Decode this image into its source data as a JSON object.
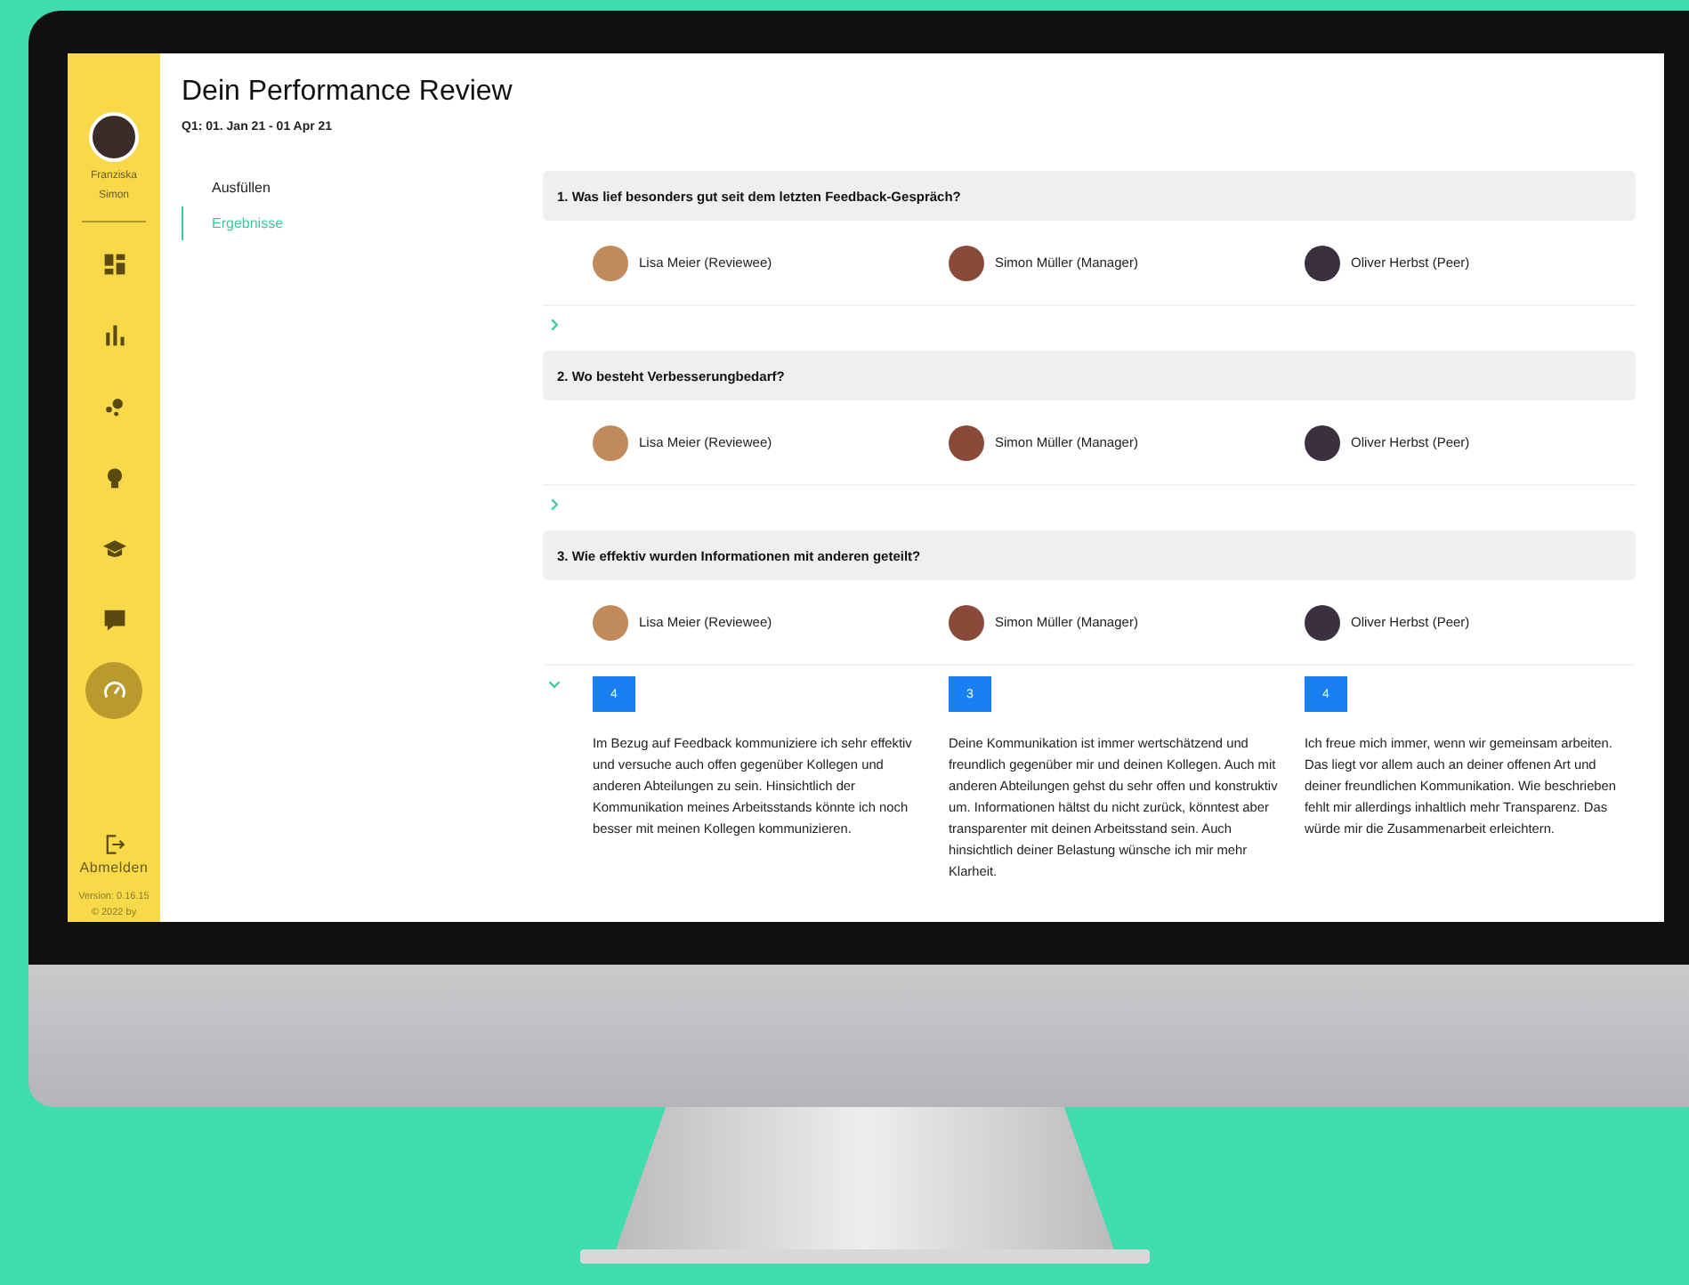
{
  "sidebar": {
    "user_name": "Franziska Simon",
    "items": [
      {
        "kind": "dashboard",
        "selected": false
      },
      {
        "kind": "chart",
        "selected": false
      },
      {
        "kind": "bubbles",
        "selected": false
      },
      {
        "kind": "bulb",
        "selected": false
      },
      {
        "kind": "cap",
        "selected": false
      },
      {
        "kind": "quote",
        "selected": false
      },
      {
        "kind": "gauge",
        "selected": true
      }
    ],
    "logout": "Abmelden",
    "version": "Version: 0.16.15",
    "copyright": "© 2022 by"
  },
  "header": {
    "title": "Dein Performance Review",
    "period": "Q1: 01. Jan 21 - 01 Apr 21"
  },
  "tabs": [
    {
      "label": "Ausfüllen",
      "selected": false
    },
    {
      "label": "Ergebnisse",
      "selected": true
    }
  ],
  "questions": [
    {
      "title": "1. Was lief besonders gut seit dem letzten Feedback-Gespräch?",
      "expanded": false,
      "reviewers": [
        "Lisa Meier (Reviewee)",
        "Simon Müller (Manager)",
        "Oliver Herbst (Peer)"
      ]
    },
    {
      "title": "2. Wo besteht Verbesserungbedarf?",
      "expanded": false,
      "reviewers": [
        "Lisa Meier (Reviewee)",
        "Simon Müller (Manager)",
        "Oliver Herbst (Peer)"
      ]
    },
    {
      "title": "3. Wie effektiv wurden Informationen mit anderen geteilt?",
      "expanded": true,
      "reviewers": [
        "Lisa Meier (Reviewee)",
        "Simon Müller (Manager)",
        "Oliver Herbst (Peer)"
      ],
      "answers": [
        {
          "score": "4",
          "text": "Im Bezug auf Feedback kommuniziere ich sehr effektiv und versuche auch offen gegenüber Kollegen und anderen Abteilungen zu sein. Hinsichtlich der Kommunikation meines Arbeitsstands könnte ich noch besser mit meinen Kollegen kommunizieren."
        },
        {
          "score": "3",
          "text": "Deine Kommunikation ist immer wertschätzend und freundlich gegenüber mir und deinen Kollegen. Auch mit anderen Abteilungen gehst du sehr offen und konstruktiv um. Informationen hältst du nicht zurück, könntest aber transparenter mit deinen Arbeitsstand sein. Auch hinsichtlich deiner Belastung wünsche ich mir mehr Klarheit."
        },
        {
          "score": "4",
          "text": "Ich freue mich immer, wenn wir gemeinsam arbeiten. Das liegt vor allem auch an deiner offenen Art und deiner freundlichen Kommunikation. Wie beschrieben fehlt mir allerdings inhaltlich mehr Transparenz. Das würde mir die Zusammenarbeit erleichtern."
        }
      ]
    }
  ]
}
